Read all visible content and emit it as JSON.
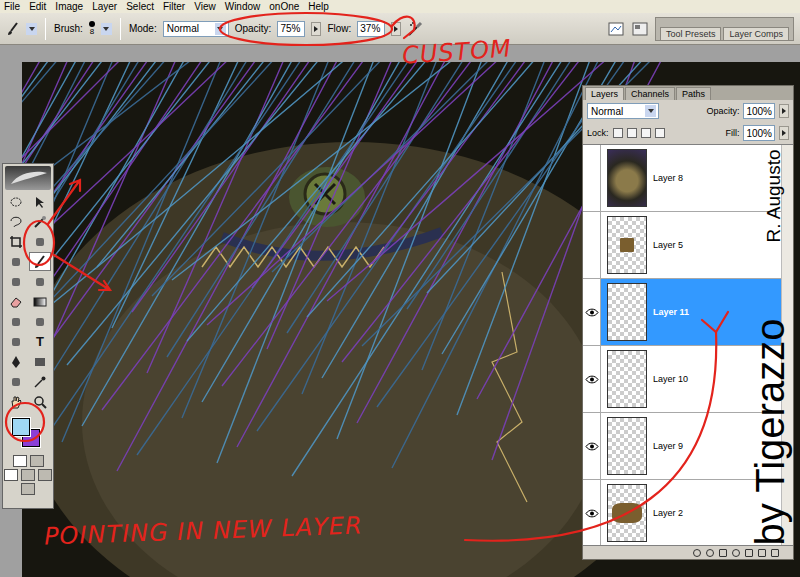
{
  "menu": [
    "File",
    "Edit",
    "Image",
    "Layer",
    "Select",
    "Filter",
    "View",
    "Window",
    "onOne",
    "Help"
  ],
  "options_bar": {
    "brush_label": "Brush:",
    "brush_size": "8",
    "mode_label": "Mode:",
    "mode": "Normal",
    "opacity_label": "Opacity:",
    "opacity": "75%",
    "flow_label": "Flow:",
    "flow": "37%",
    "well_tabs": [
      {
        "label": "Tool Presets",
        "selected": false
      },
      {
        "label": "Layer Comps",
        "selected": false
      }
    ]
  },
  "toolbox": {
    "type_tool": "T",
    "foreground_color": "#9fd8f4",
    "background_color": "#8b3fd6"
  },
  "layers_panel": {
    "tabs": [
      {
        "label": "Layers",
        "selected": true
      },
      {
        "label": "Channels",
        "selected": false
      },
      {
        "label": "Paths",
        "selected": false
      }
    ],
    "blend_mode": "Normal",
    "opacity_label": "Opacity:",
    "opacity": "100%",
    "lock_label": "Lock:",
    "fill_label": "Fill:",
    "fill": "100%",
    "layers": [
      {
        "name": "Layer 8",
        "visible": false,
        "selected": false,
        "kind": "face"
      },
      {
        "name": "Layer 5",
        "visible": false,
        "selected": false,
        "kind": "patch"
      },
      {
        "name": "Layer 11",
        "visible": true,
        "selected": true,
        "kind": "empty"
      },
      {
        "name": "Layer 10",
        "visible": true,
        "selected": false,
        "kind": "empty"
      },
      {
        "name": "Layer 9",
        "visible": true,
        "selected": false,
        "kind": "empty"
      },
      {
        "name": "Layer 2",
        "visible": true,
        "selected": false,
        "kind": "blob"
      }
    ]
  },
  "annotations": [
    {
      "text": "CUSTOM"
    },
    {
      "text": "POINTING IN NEW LAYER"
    }
  ],
  "watermark": {
    "author": "by Tigerazzo",
    "name": "R. Augusto"
  }
}
